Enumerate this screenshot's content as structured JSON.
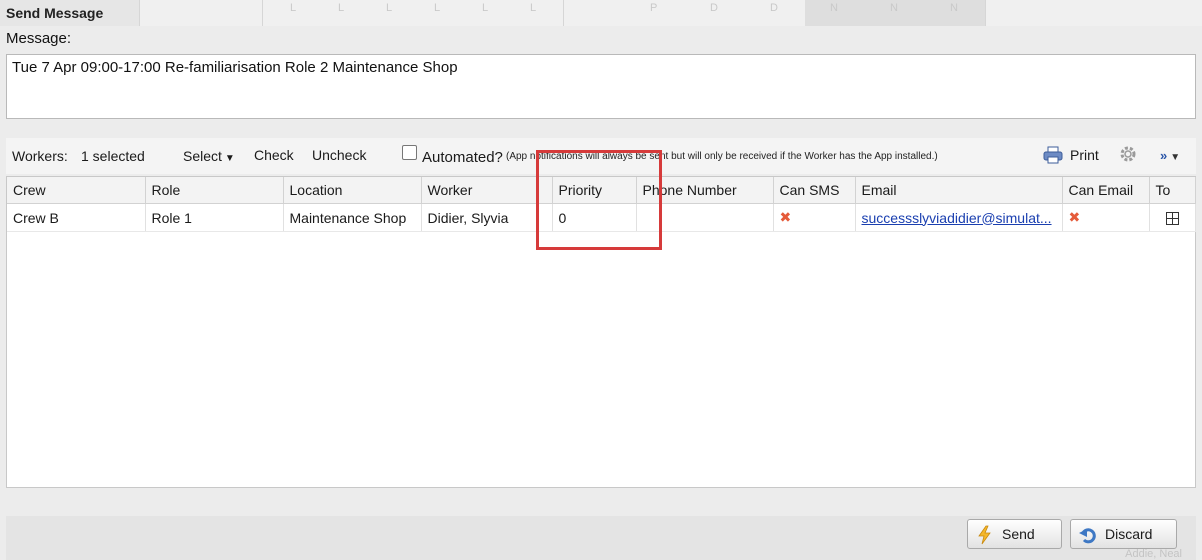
{
  "window": {
    "title": "Send Message"
  },
  "background_grid_letters": [
    "L",
    "L",
    "L",
    "L",
    "L",
    "L",
    "P",
    "D",
    "D",
    "N",
    "N",
    "N"
  ],
  "message": {
    "label": "Message:",
    "text": "Tue 7 Apr 09:00-17:00 Re-familiarisation Role 2 Maintenance Shop"
  },
  "toolbar": {
    "workers_label": "Workers:",
    "selected_count": "1 selected",
    "select_label": "Select",
    "check_label": "Check",
    "uncheck_label": "Uncheck",
    "automated_label": "Automated?",
    "automated_note": "(App notifications will always be sent but will only be received if the Worker has the App installed.)",
    "automated_checked": false,
    "print_label": "Print",
    "icons": [
      "printer-icon",
      "gear-icon",
      "more-icon"
    ]
  },
  "table": {
    "columns": [
      "Crew",
      "Role",
      "Location",
      "Worker",
      "Priority",
      "Phone Number",
      "Can SMS",
      "Email",
      "Can Email",
      "To"
    ],
    "rows": [
      {
        "crew": "Crew B",
        "role": "Role 1",
        "location": "Maintenance Shop",
        "worker": "Didier, Slyvia",
        "priority": "0",
        "phone": "",
        "can_sms": "✖",
        "email": "successslyviadidier@simulat...",
        "can_email": "✖",
        "to_icon": "grid-icon"
      }
    ]
  },
  "footer": {
    "send_label": "Send",
    "discard_label": "Discard",
    "ghost_text": "Addie, Neal"
  },
  "colors": {
    "highlight": "#d63a3a",
    "cross": "#e55b3a",
    "link": "#1a3fb0"
  }
}
